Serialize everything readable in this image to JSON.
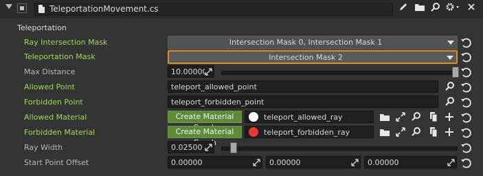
{
  "header": {
    "filename": "TeleportationMovement.cs",
    "icons": [
      "pencil-icon",
      "folder-icon",
      "search-icon",
      "gear-icon",
      "close-icon"
    ]
  },
  "section_title": "Teleportation",
  "rows": {
    "ray_intersection_mask": {
      "label": "Ray Intersection Mask",
      "value": "Intersection Mask 0, Intersection Mask 1"
    },
    "teleportation_mask": {
      "label": "Teleportation Mask",
      "value": "Intersection Mask 2"
    },
    "max_distance": {
      "label": "Max Distance",
      "value": "10.00000",
      "slider_level": 1.0
    },
    "allowed_point": {
      "label": "Allowed Point",
      "value": "teleport_allowed_point"
    },
    "forbidden_point": {
      "label": "Forbidden Point",
      "value": "teleport_forbidden_point"
    },
    "allowed_material": {
      "label": "Allowed Material",
      "button": "Create Material Graph",
      "value": "teleport_allowed_ray",
      "swatch_color": "#ffffff"
    },
    "forbidden_material": {
      "label": "Forbidden Material",
      "button": "Create Material Graph",
      "value": "teleport_forbidden_ray",
      "swatch_color": "#e53935"
    },
    "ray_width": {
      "label": "Ray Width",
      "value": "0.02500",
      "slider_level": 0.025
    },
    "start_point_offset": {
      "label": "Start Point Offset",
      "x": "0.00000",
      "y": "0.00000",
      "z": "0.00000"
    }
  },
  "colors": {
    "accent_green": "#a3d65a",
    "focus_orange": "#e08f1e",
    "button_green": "#5e8a3a"
  }
}
